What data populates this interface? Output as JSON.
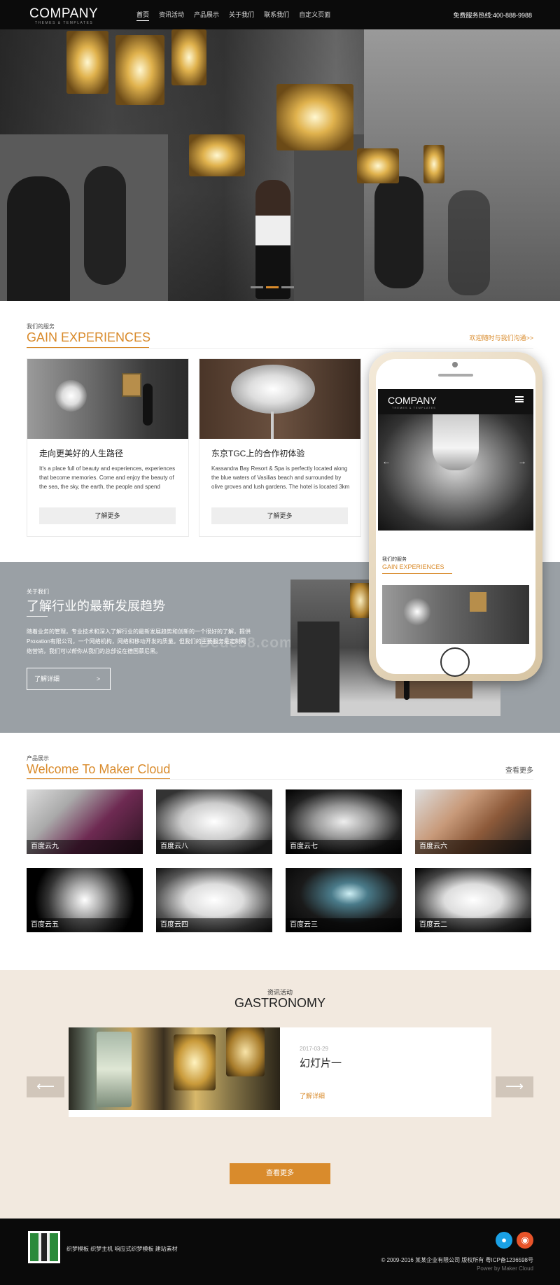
{
  "header": {
    "logo": "COMPANY",
    "logo_sub": "THEMES & TEMPLATES",
    "nav": [
      {
        "label": "首页"
      },
      {
        "label": "资讯活动"
      },
      {
        "label": "产品展示"
      },
      {
        "label": "关于我们"
      },
      {
        "label": "联系我们"
      },
      {
        "label": "自定义页面"
      }
    ],
    "hotline": "免费服务热线:400-888-9988"
  },
  "hero": {
    "slides": 3,
    "active_slide": 2
  },
  "services": {
    "small": "我们的服务",
    "title": "GAIN EXPERIENCES",
    "link": "欢迎随时与我们沟通>>",
    "cards": [
      {
        "title": "走向更美好的人生路径",
        "text": "It's a place full of beauty and experiences, experiences that become memories. Come and enjoy the beauty of the sea, the sky, the earth, the people and spend",
        "button": "了解更多"
      },
      {
        "title": "东京TGC上的合作初体验",
        "text": "Kassandra Bay Resort & Spa is perfectly located along the blue waters of Vasilias beach and surrounded by olive groves and lush gardens. The hotel is located 3km",
        "button": "了解更多"
      }
    ]
  },
  "about": {
    "small": "关于我们",
    "title": "了解行业的最新发展趋势",
    "text": "随着业务的管理，专业技术和深入了解行业的最新发展趋势和创新的一个很好的了解，提供Proxation有限公司，一个网络机构，网络和移动开发的质量。但我们的主要服务是定制网络营销，我们可以帮你从我们的总部设在德国慕尼黑。",
    "button": "了解详细",
    "button_arrow": ">",
    "watermark": "Dede58.com"
  },
  "phone": {
    "logo": "COMPANY",
    "logo_sub": "THEMES & TEMPLATES",
    "small": "我们的服务",
    "title": "GAIN EXPERIENCES"
  },
  "products": {
    "small": "产品展示",
    "title": "Welcome To Maker Cloud",
    "more": "查看更多",
    "items": [
      {
        "label": "百度云九"
      },
      {
        "label": "百度云八"
      },
      {
        "label": "百度云七"
      },
      {
        "label": "百度云六"
      },
      {
        "label": "百度云五"
      },
      {
        "label": "百度云四"
      },
      {
        "label": "百度云三"
      },
      {
        "label": "百度云二"
      }
    ]
  },
  "news": {
    "small": "资讯活动",
    "title": "GASTRONOMY",
    "date": "2017-03-29",
    "headline": "幻灯片一",
    "link": "了解详细",
    "more_button": "查看更多"
  },
  "footer": {
    "links": "织梦模板 织梦主机 响应式织梦模板 建站素材",
    "copyright": "© 2009-2016 某某企业有限公司 版权所有 粤ICP备1236598号",
    "power": "Power by Maker Cloud"
  },
  "colors": {
    "accent": "#d98b2c",
    "dark": "#0b0b0b",
    "about_bg": "#9aa0a5",
    "news_bg": "#f2e9df"
  }
}
